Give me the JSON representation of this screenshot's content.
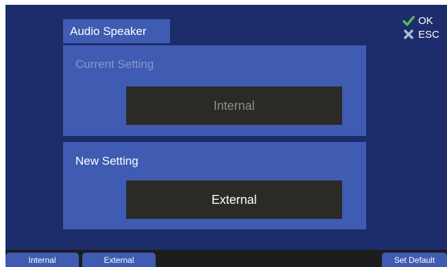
{
  "header": {
    "title": "Audio Speaker"
  },
  "current": {
    "label": "Current Setting",
    "value": "Internal"
  },
  "new": {
    "label": "New Setting",
    "value": "External"
  },
  "actions": {
    "ok": {
      "label": "OK",
      "icon": "check-icon",
      "color": "#5cb85c"
    },
    "esc": {
      "label": "ESC",
      "icon": "x-icon",
      "color": "#a8c0d8"
    }
  },
  "softkeys": [
    {
      "label": "Internal"
    },
    {
      "label": "External"
    },
    {
      "label": "Set Default"
    }
  ],
  "colors": {
    "background": "#1d2d6b",
    "panel": "#3f5cb2",
    "value_box": "#2b2a27",
    "bottom_bar": "#1d1d1d"
  }
}
